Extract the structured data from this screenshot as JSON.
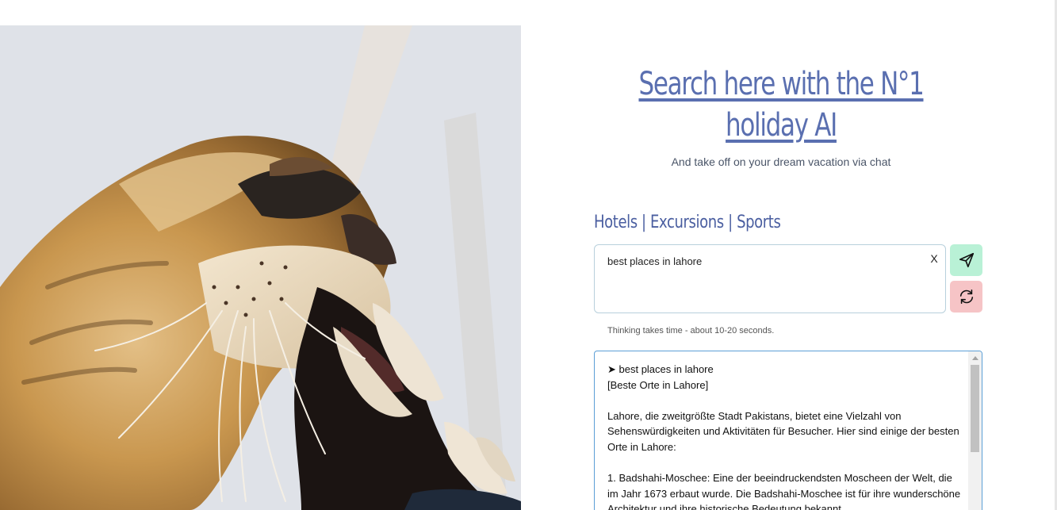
{
  "hero": {
    "title": "Search here with the N°1 holiday AI",
    "subtitle": "And take off on your dream vacation via chat"
  },
  "categories": [
    "Hotels",
    "Excursions",
    "Sports"
  ],
  "category_separator": " | ",
  "search": {
    "value": "best places in lahore",
    "clear_label": "X"
  },
  "icons": {
    "send": "send-icon",
    "reset": "refresh-icon"
  },
  "hint": "Thinking takes time - about 10-20 seconds.",
  "answer": {
    "text": "➤ best places in lahore\n[Beste Orte in Lahore]\n\nLahore, die zweitgrößte Stadt Pakistans, bietet eine Vielzahl von Sehenswürdigkeiten und Aktivitäten für Besucher. Hier sind einige der besten Orte in Lahore:\n\n1. Badshahi-Moschee: Eine der beeindruckendsten Moscheen der Welt, die im Jahr 1673 erbaut wurde. Die Badshahi-Moschee ist für ihre wunderschöne Architektur und ihre historische Bedeutung bekannt."
  },
  "colors": {
    "heading": "#5a6fb0",
    "send_button": "#b9f1d6",
    "reset_button": "#f6c4c6",
    "answer_border": "#5c9fd6"
  }
}
